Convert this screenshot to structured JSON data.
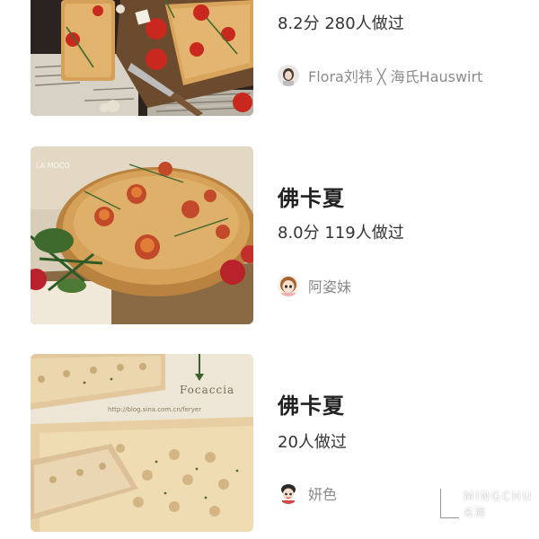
{
  "recipes": [
    {
      "title": "",
      "stats": "8.2分 280人做过",
      "author": "Flora刘祎 ╳ 海氏Hauswirt",
      "image_icon": "focaccia-tomato-rosemary-photo"
    },
    {
      "title": "佛卡夏",
      "stats": "8.0分 119人做过",
      "author": "阿姿妹",
      "image_icon": "focaccia-round-cherry-tomato-photo"
    },
    {
      "title": "佛卡夏",
      "stats": "20人做过",
      "author": "妍色",
      "image_icon": "focaccia-herb-dimpled-bread-photo",
      "image_caption": "Focaccia",
      "image_url_text": "http://blog.sina.com.cn/feryer"
    }
  ],
  "watermark": {
    "brand_en": "MINGCHU",
    "brand_cn": "名厨"
  },
  "photo_watermark_card2": "LA MOCO"
}
